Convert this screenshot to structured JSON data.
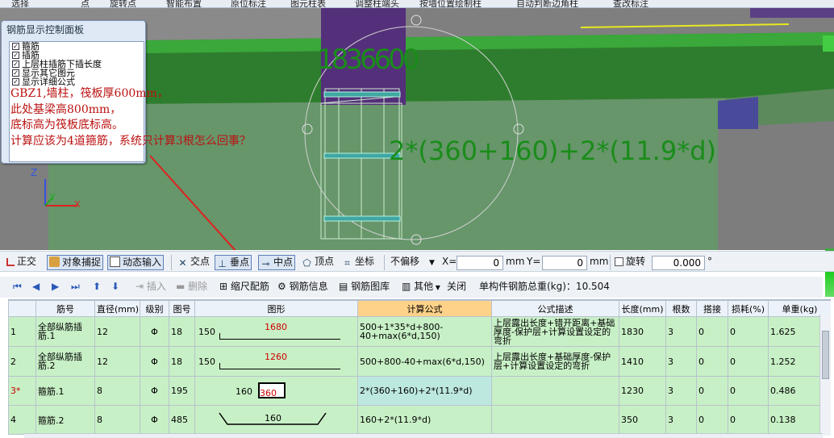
{
  "top_menu": [
    "选择",
    "点",
    "旋转点",
    "智能布置",
    "原位标注",
    "图元柱表",
    "调整柱端头",
    "按墙位置绘制柱",
    "自动判断边角柱",
    "查改标注"
  ],
  "panel": {
    "title": "钢筋显示控制面板",
    "checks": [
      {
        "label": "箍筋",
        "checked": true
      },
      {
        "label": "插筋",
        "checked": true
      },
      {
        "label": "上层柱插筋下插长度",
        "checked": true
      },
      {
        "label": "显示其它图元",
        "checked": true
      },
      {
        "label": "显示详细公式",
        "checked": true
      }
    ]
  },
  "viewport": {
    "dim_text_top": "1836600",
    "formula_label": "2*(360+160)+2*(11.9*d)",
    "axis_labels": {
      "z": "Z",
      "y": "Y",
      "x": "X"
    }
  },
  "annotation": [
    "GBZ1,墙柱，筏板厚600mm，",
    "此处基梁高800mm，",
    "底标高为筏板底标高。",
    "计算应该为4道箍筋，系统只计算3根怎么回事？"
  ],
  "toolbar1": {
    "ortho": "正交",
    "snap": "对象捕捉",
    "dynamic_input": "动态输入",
    "intersection": "交点",
    "perpendicular": "垂点",
    "midpoint": "中点",
    "vertex": "顶点",
    "coordinate": "坐标",
    "offset_select": "不偏移",
    "x_label": "X=",
    "x_value": "0",
    "x_unit": "mm",
    "y_label": "Y=",
    "y_value": "0",
    "y_unit": "mm",
    "rotate_label": "旋转",
    "rotate_value": "0.000",
    "rotate_unit": "°"
  },
  "toolbar2": {
    "insert": "插入",
    "delete": "删除",
    "scale_rebar": "缩尺配筋",
    "rebar_info": "钢筋信息",
    "rebar_library": "钢筋图库",
    "other": "其他",
    "close": "关闭",
    "total_weight_label": "单构件钢筋总重(kg)：10.504"
  },
  "table": {
    "headers": [
      "",
      "筋号",
      "直径(mm)",
      "级别",
      "图号",
      "图形",
      "计算公式",
      "公式描述",
      "长度(mm)",
      "根数",
      "搭接",
      "损耗(%)",
      "单重(kg)"
    ],
    "rows": [
      {
        "num": "1",
        "name": "全部纵筋插筋.1",
        "dia": "12",
        "grade": "Φ",
        "fig": "18",
        "shape_left": "150",
        "shape_mid": "1680",
        "formula": "500+1*35*d+800-40+max(6*d,150)",
        "desc": "上层露出长度+错开距离+基础厚度-保护层+计算设置设定的弯折",
        "length": "1830",
        "count": "3",
        "lap": "0",
        "loss": "0",
        "unit_wt": "1.625"
      },
      {
        "num": "2",
        "name": "全部纵筋插筋.2",
        "dia": "12",
        "grade": "Φ",
        "fig": "18",
        "shape_left": "150",
        "shape_mid": "1260",
        "formula": "500+800-40+max(6*d,150)",
        "desc": "上层露出长度+基础厚度-保护层+计算设置设定的弯折",
        "length": "1410",
        "count": "3",
        "lap": "0",
        "loss": "0",
        "unit_wt": "1.252"
      },
      {
        "num": "3*",
        "name": "箍筋.1",
        "dia": "8",
        "grade": "Φ",
        "fig": "195",
        "shape_left": "160",
        "shape_mid": "360",
        "formula": "2*(360+160)+2*(11.9*d)",
        "desc": "",
        "length": "1230",
        "count": "3",
        "lap": "0",
        "loss": "0",
        "unit_wt": "0.486"
      },
      {
        "num": "4",
        "name": "箍筋.2",
        "dia": "8",
        "grade": "Φ",
        "fig": "485",
        "shape_left": "",
        "shape_mid": "160",
        "formula": "160+2*(11.9*d)",
        "desc": "",
        "length": "350",
        "count": "3",
        "lap": "0",
        "loss": "0",
        "unit_wt": "0.138"
      }
    ]
  },
  "colors": {
    "row_bg": "#c8f0c6",
    "selected_cell": "#bde8e0",
    "header_highlight": "#ffd28a",
    "annotation": "#b11111",
    "dim_green": "#1a8c1a",
    "arrow": "#e02020"
  }
}
